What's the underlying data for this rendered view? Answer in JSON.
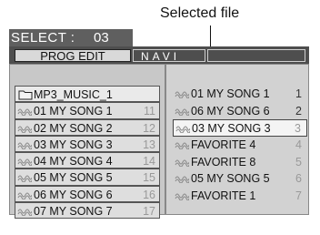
{
  "callout": {
    "text": "Selected file"
  },
  "select_bar": {
    "label": "SELECT :",
    "value": "03"
  },
  "tabs": [
    {
      "label": "PROG EDIT"
    },
    {
      "label": "NAVI"
    },
    {
      "label": ""
    }
  ],
  "left_list": {
    "folder": {
      "name": "MP3_MUSIC_1",
      "icon": "folder-icon"
    },
    "items": [
      {
        "name": "01 MY SONG 1",
        "num": "11",
        "icon": "mp3-file-icon"
      },
      {
        "name": "02 MY SONG 2",
        "num": "12",
        "icon": "mp3-file-icon"
      },
      {
        "name": "03 MY SONG 3",
        "num": "13",
        "icon": "mp3-file-icon"
      },
      {
        "name": "04 MY SONG 4",
        "num": "14",
        "icon": "mp3-file-icon"
      },
      {
        "name": "05 MY SONG 5",
        "num": "15",
        "icon": "mp3-file-icon"
      },
      {
        "name": "06 MY SONG 6",
        "num": "16",
        "icon": "mp3-file-icon"
      },
      {
        "name": "07 MY SONG 7",
        "num": "17",
        "icon": "mp3-file-icon"
      }
    ]
  },
  "right_list": {
    "items": [
      {
        "name": "01 MY SONG 1",
        "num": "1",
        "icon": "mp3-file-icon"
      },
      {
        "name": "06 MY SONG 6",
        "num": "2",
        "icon": "mp3-file-icon"
      },
      {
        "name": "03 MY SONG 3",
        "num": "3",
        "icon": "mp3-file-icon",
        "selected": true
      },
      {
        "name": "FAVORITE 4",
        "num": "4",
        "icon": "mp3-file-icon"
      },
      {
        "name": "FAVORITE 8",
        "num": "5",
        "icon": "mp3-file-icon"
      },
      {
        "name": "05 MY SONG 5",
        "num": "6",
        "icon": "mp3-file-icon"
      },
      {
        "name": "FAVORITE 1",
        "num": "7",
        "icon": "mp3-file-icon"
      }
    ]
  }
}
